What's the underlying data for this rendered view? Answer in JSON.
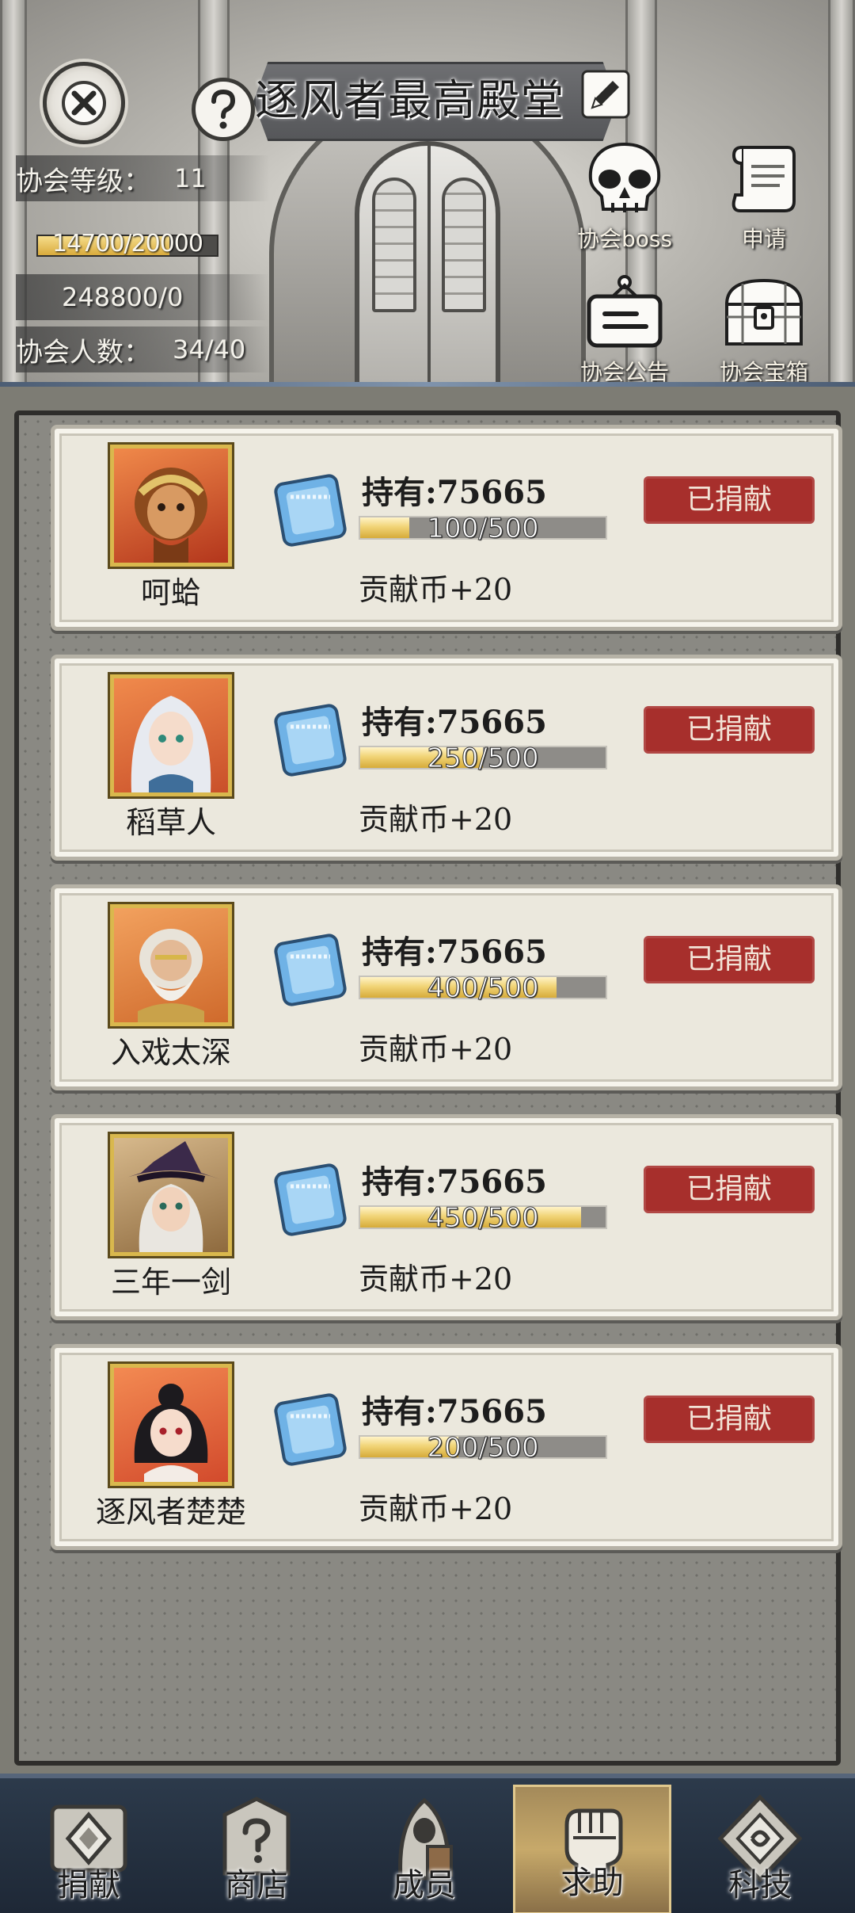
{
  "header": {
    "title": "逐风者最高殿堂",
    "level_label": "协会等级：",
    "level_value": "11",
    "exp_text": "14700/20000",
    "exp_fraction": 0.735,
    "funds_text": "248800/0",
    "members_label": "协会人数：",
    "members_value": "34/40",
    "side_buttons": [
      {
        "label": "协会boss",
        "icon": "skull-icon"
      },
      {
        "label": "申请",
        "icon": "scroll-icon"
      },
      {
        "label": "协会公告",
        "icon": "notice-board-icon"
      },
      {
        "label": "协会宝箱",
        "icon": "treasure-chest-icon"
      }
    ]
  },
  "requests": [
    {
      "name": "呵蛤",
      "hold": "持有:75665",
      "progress_text": "100/500",
      "progress": 0.2,
      "reward": "贡献币+20",
      "status": "已捐献"
    },
    {
      "name": "稻草人",
      "hold": "持有:75665",
      "progress_text": "250/500",
      "progress": 0.5,
      "reward": "贡献币+20",
      "status": "已捐献"
    },
    {
      "name": "入戏太深",
      "hold": "持有:75665",
      "progress_text": "400/500",
      "progress": 0.8,
      "reward": "贡献币+20",
      "status": "已捐献"
    },
    {
      "name": "三年一剑",
      "hold": "持有:75665",
      "progress_text": "450/500",
      "progress": 0.9,
      "reward": "贡献币+20",
      "status": "已捐献"
    },
    {
      "name": "逐风者楚楚",
      "hold": "持有:75665",
      "progress_text": "200/500",
      "progress": 0.4,
      "reward": "贡献币+20",
      "status": "已捐献"
    }
  ],
  "nav": [
    {
      "label": "捐献",
      "icon": "donate-icon",
      "active": false
    },
    {
      "label": "商店",
      "icon": "shop-icon",
      "active": false
    },
    {
      "label": "成员",
      "icon": "members-icon",
      "active": false
    },
    {
      "label": "求助",
      "icon": "help-fist-icon",
      "active": true
    },
    {
      "label": "科技",
      "icon": "tech-icon",
      "active": false
    }
  ],
  "colors": {
    "donated_badge": "#a72f2c",
    "progress_fill": "#f1d477",
    "nav_active": "#c7a96a",
    "panel": "#8a8983",
    "card": "#ebe8dd"
  }
}
